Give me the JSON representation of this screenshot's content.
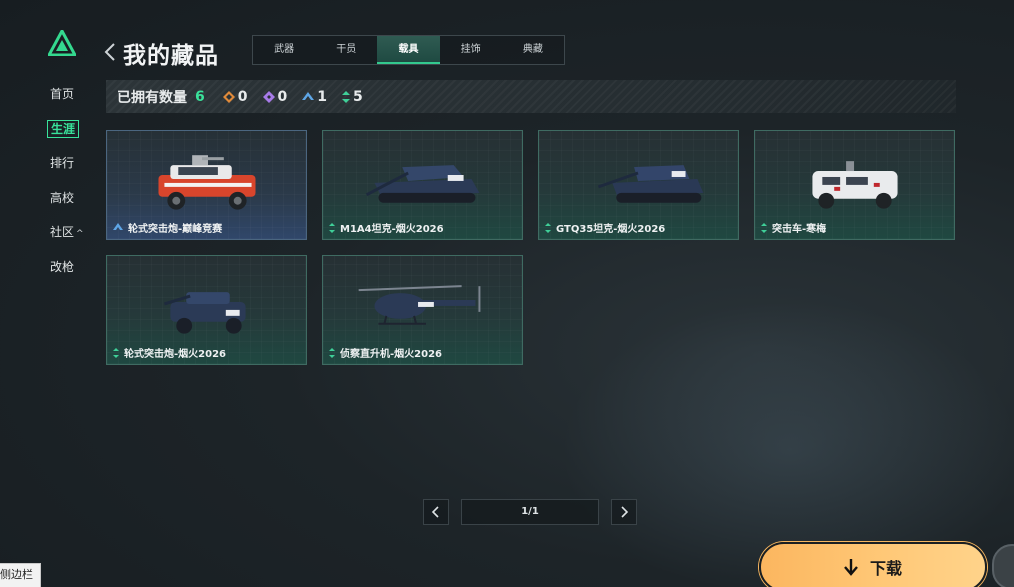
{
  "sidebar": {
    "items": [
      {
        "label": "首页"
      },
      {
        "label": "生涯"
      },
      {
        "label": "排行"
      },
      {
        "label": "高校"
      },
      {
        "label": "社区",
        "caret": "^"
      },
      {
        "label": "改枪"
      }
    ],
    "active_index": 1
  },
  "header": {
    "title": "我的藏品",
    "tabs": [
      "武器",
      "干员",
      "载具",
      "挂饰",
      "典藏"
    ],
    "active_tab": 2
  },
  "stats": {
    "label": "已拥有数量",
    "total": "6",
    "counts": [
      {
        "icon": "orange-diamond-icon",
        "value": "0",
        "color": "#e08a3a"
      },
      {
        "icon": "purple-diamond-icon",
        "value": "0",
        "color": "#a77be8"
      },
      {
        "icon": "blue-chevron-icon",
        "value": "1",
        "color": "#5ea6e6"
      },
      {
        "icon": "green-arrows-icon",
        "value": "5",
        "color": "#3fcf98"
      }
    ]
  },
  "items": [
    {
      "name": "轮式突击炮-巅峰竞赛",
      "rarity": "blue"
    },
    {
      "name": "M1A4坦克-烟火2026",
      "rarity": "green"
    },
    {
      "name": "GTQ35坦克-烟火2026",
      "rarity": "green"
    },
    {
      "name": "突击车-寒梅",
      "rarity": "green"
    },
    {
      "name": "轮式突击炮-烟火2026",
      "rarity": "green"
    },
    {
      "name": "侦察直升机-烟火2026",
      "rarity": "green"
    }
  ],
  "pager": {
    "label": "1/1"
  },
  "download": {
    "label": "下载"
  },
  "sidebar_toggle": {
    "label": "侧边栏"
  }
}
